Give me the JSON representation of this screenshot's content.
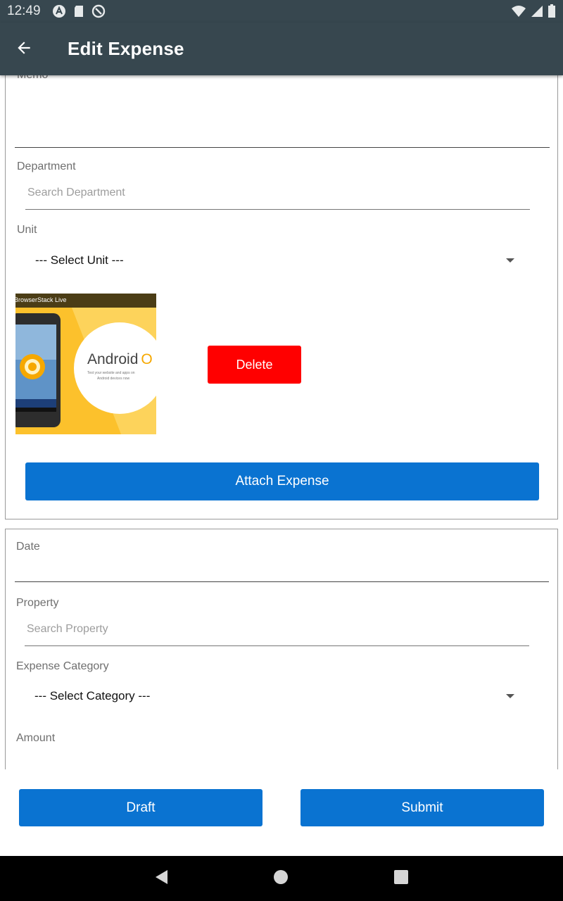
{
  "status_bar": {
    "time": "12:49",
    "left_icons": [
      "app-a-icon",
      "sd-card-icon",
      "vpn-icon"
    ],
    "right_icons": [
      "wifi-icon",
      "signal-icon",
      "battery-icon"
    ]
  },
  "app_bar": {
    "back_icon": "arrow-left-icon",
    "title": "Edit Expense"
  },
  "form": {
    "memo": {
      "label": "Memo",
      "value": ""
    },
    "department": {
      "label": "Department",
      "placeholder": "Search Department"
    },
    "unit": {
      "label": "Unit",
      "selected": "--- Select Unit ---"
    },
    "attachment": {
      "thumbnail_header": "BrowserStack  Live",
      "thumbnail_brand": "Android",
      "thumbnail_brand_letter": "O",
      "thumbnail_tagline_1": "Test your website and apps on",
      "thumbnail_tagline_2": "Android devices now",
      "delete_label": "Delete"
    },
    "attach_label": "Attach Expense",
    "date": {
      "label": "Date",
      "value": ""
    },
    "property": {
      "label": "Property",
      "placeholder": "Search Property"
    },
    "category": {
      "label": "Expense Category",
      "selected": "--- Select Category ---"
    },
    "amount": {
      "label": "Amount",
      "value": ""
    }
  },
  "actions": {
    "draft_label": "Draft",
    "submit_label": "Submit"
  },
  "nav_bar": {
    "icons": [
      "back-triangle-icon",
      "home-circle-icon",
      "recents-square-icon"
    ]
  },
  "colors": {
    "app_bar": "#37474f",
    "primary_button": "#0a73d1",
    "delete_button": "#ff0000",
    "nav_bar": "#000000"
  }
}
